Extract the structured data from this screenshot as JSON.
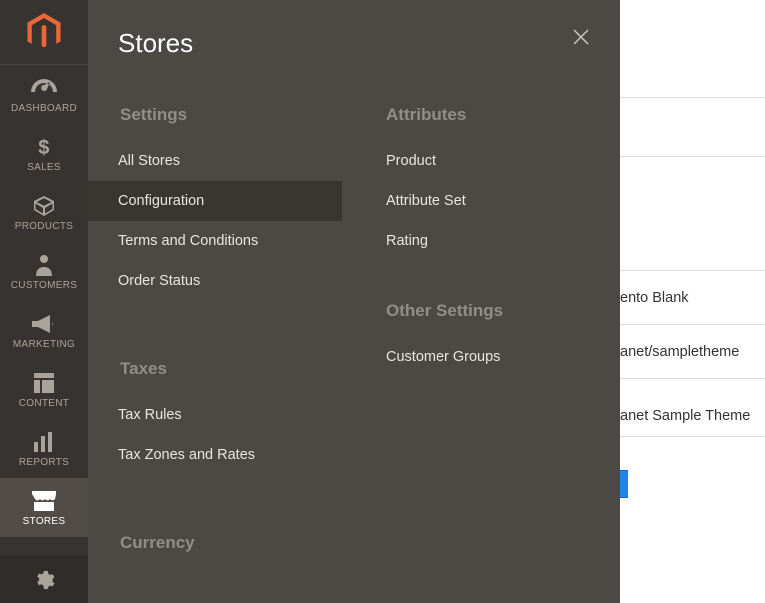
{
  "sidebar": {
    "items": [
      {
        "label": "DASHBOARD"
      },
      {
        "label": "SALES"
      },
      {
        "label": "PRODUCTS"
      },
      {
        "label": "CUSTOMERS"
      },
      {
        "label": "MARKETING"
      },
      {
        "label": "CONTENT"
      },
      {
        "label": "REPORTS"
      },
      {
        "label": "STORES"
      }
    ]
  },
  "flyout": {
    "title": "Stores",
    "sections_left": [
      {
        "heading": "Settings",
        "items": [
          {
            "label": "All Stores",
            "selected": false
          },
          {
            "label": "Configuration",
            "selected": true
          },
          {
            "label": "Terms and Conditions",
            "selected": false
          },
          {
            "label": "Order Status",
            "selected": false
          }
        ]
      },
      {
        "heading": "Taxes",
        "items": [
          {
            "label": "Tax Rules"
          },
          {
            "label": "Tax Zones and Rates"
          }
        ]
      },
      {
        "heading": "Currency",
        "items": []
      }
    ],
    "sections_right": [
      {
        "heading": "Attributes",
        "items": [
          {
            "label": "Product"
          },
          {
            "label": "Attribute Set"
          },
          {
            "label": "Rating"
          }
        ]
      },
      {
        "heading": "Other Settings",
        "items": [
          {
            "label": "Customer Groups"
          }
        ]
      }
    ]
  },
  "peek": {
    "line1": "ento Blank",
    "line2": "anet/sampletheme",
    "line3": "anet Sample Theme"
  }
}
